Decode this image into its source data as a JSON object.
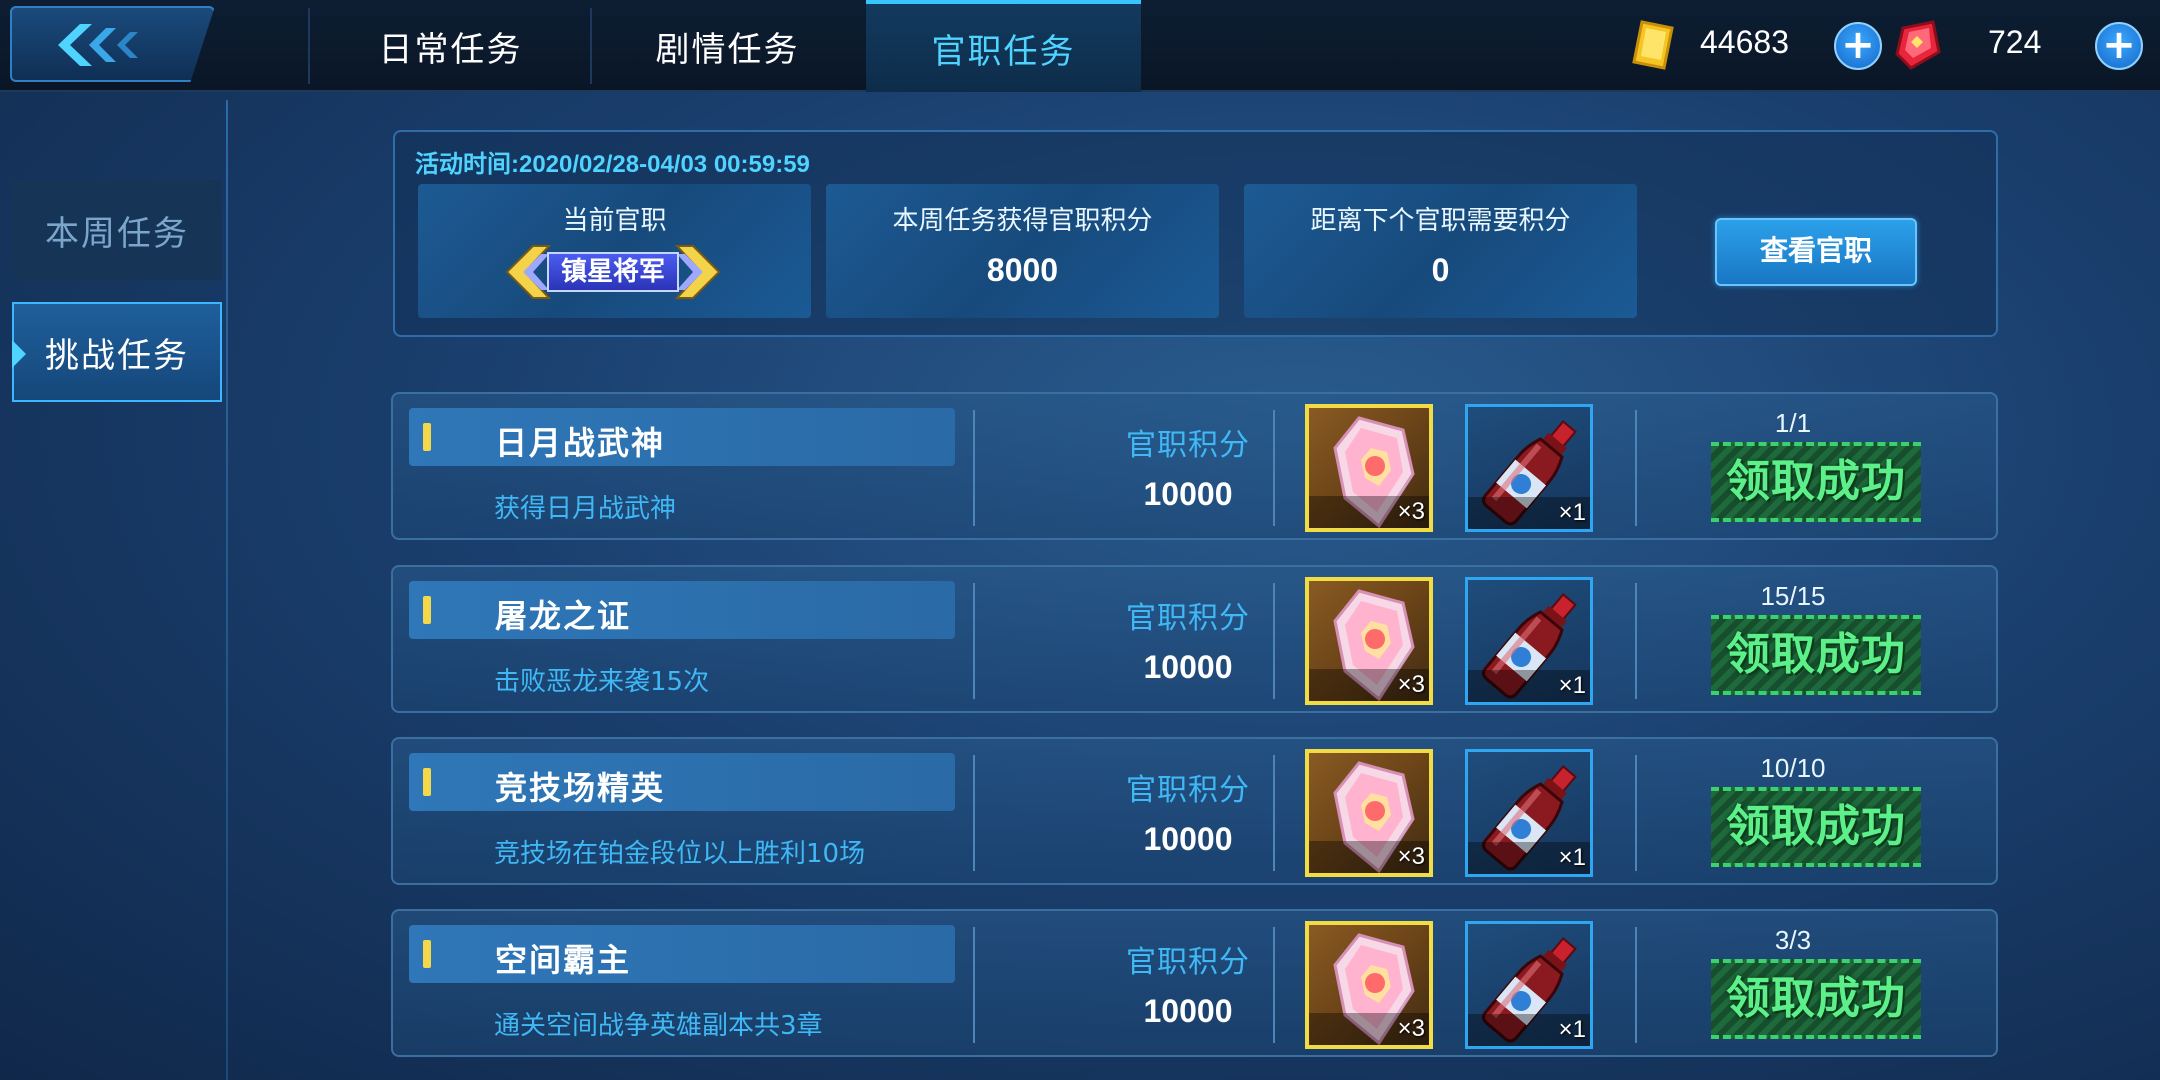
{
  "header": {
    "tabs": [
      {
        "label": "日常任务",
        "active": false
      },
      {
        "label": "剧情任务",
        "active": false
      },
      {
        "label": "官职任务",
        "active": true
      }
    ],
    "gold": {
      "value": "44683",
      "icon": "gold-bar-icon"
    },
    "gems": {
      "value": "724",
      "icon": "red-gem-icon"
    },
    "plus_icon": "plus-icon"
  },
  "sidebar": {
    "items": [
      {
        "label": "本周任务",
        "active": false
      },
      {
        "label": "挑战任务",
        "active": true
      }
    ]
  },
  "info": {
    "activity_time": "活动时间:2020/02/28-04/03 00:59:59",
    "current_rank_label": "当前官职",
    "current_rank": "镇星将军",
    "weekly_points_label": "本周任务获得官职积分",
    "weekly_points": "8000",
    "next_rank_label": "距离下个官职需要积分",
    "next_rank_points": "0",
    "view_rank_button": "查看官职"
  },
  "tasks": [
    {
      "title": "日月战武神",
      "desc": "获得日月战武神",
      "points_label": "官职积分",
      "points": "10000",
      "rewards": [
        {
          "icon": "crystal-icon",
          "qty": "×3"
        },
        {
          "icon": "potion-bottle-icon",
          "qty": "×1"
        }
      ],
      "progress": "1/1",
      "status": "领取成功"
    },
    {
      "title": "屠龙之证",
      "desc": "击败恶龙来袭15次",
      "points_label": "官职积分",
      "points": "10000",
      "rewards": [
        {
          "icon": "crystal-icon",
          "qty": "×3"
        },
        {
          "icon": "potion-bottle-icon",
          "qty": "×1"
        }
      ],
      "progress": "15/15",
      "status": "领取成功"
    },
    {
      "title": "竞技场精英",
      "desc": "竞技场在铂金段位以上胜利10场",
      "points_label": "官职积分",
      "points": "10000",
      "rewards": [
        {
          "icon": "crystal-icon",
          "qty": "×3"
        },
        {
          "icon": "potion-bottle-icon",
          "qty": "×1"
        }
      ],
      "progress": "10/10",
      "status": "领取成功"
    },
    {
      "title": "空间霸主",
      "desc": "通关空间战争英雄副本共3章",
      "points_label": "官职积分",
      "points": "10000",
      "rewards": [
        {
          "icon": "crystal-icon",
          "qty": "×3"
        },
        {
          "icon": "potion-bottle-icon",
          "qty": "×1"
        }
      ],
      "progress": "3/3",
      "status": "领取成功"
    }
  ]
}
